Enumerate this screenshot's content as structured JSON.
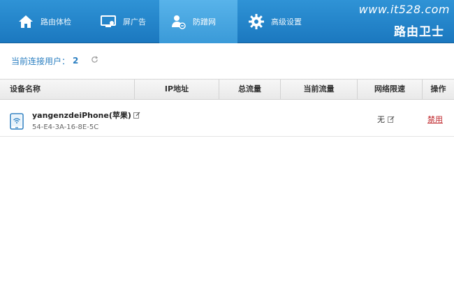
{
  "nav": {
    "tabs": [
      {
        "label": "路由体检",
        "icon": "home-icon"
      },
      {
        "label": "屏广告",
        "icon": "monitor-icon"
      },
      {
        "label": "防蹭网",
        "icon": "user-shield-icon",
        "active": true
      },
      {
        "label": "高级设置",
        "icon": "gear-icon"
      }
    ],
    "watermark": "www.it528.com",
    "brand": "路由卫士"
  },
  "connection": {
    "label": "当前连接用户：",
    "count": "2",
    "refresh_icon": "refresh-icon"
  },
  "table": {
    "headers": [
      "设备名称",
      "IP地址",
      "总流量",
      "当前流量",
      "网络限速",
      "操作"
    ],
    "rows": [
      {
        "name": "yangenzdeiPhone(苹果)",
        "mac": "54-E4-3A-16-8E-5C",
        "ip": "",
        "total": "",
        "current": "",
        "limit": "无",
        "action": "禁用",
        "device_icon": "tablet-wifi-icon"
      }
    ]
  },
  "colors": {
    "nav_bg": "#1b78bf",
    "nav_active": "#3a9ad8",
    "accent_text": "#2b7fc1",
    "action_red": "#c0282d"
  }
}
